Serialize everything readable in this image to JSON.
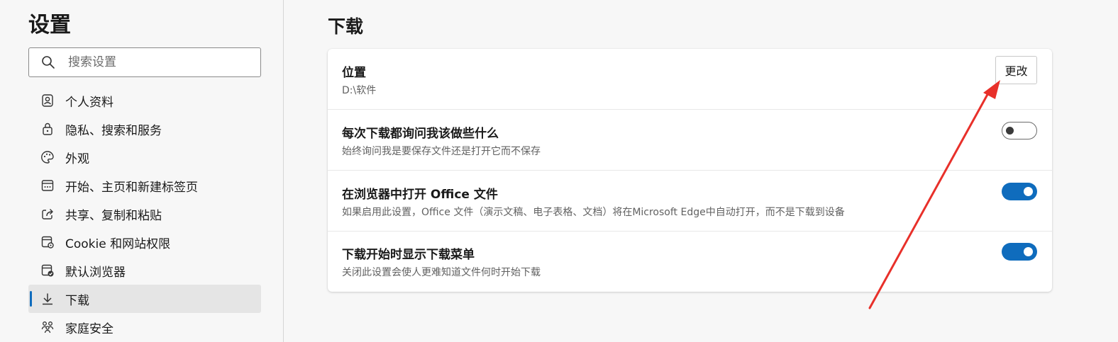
{
  "sidebar": {
    "title": "设置",
    "search_placeholder": "搜索设置",
    "items": [
      {
        "label": "个人资料",
        "icon": "profile-icon"
      },
      {
        "label": "隐私、搜索和服务",
        "icon": "lock-icon"
      },
      {
        "label": "外观",
        "icon": "palette-icon"
      },
      {
        "label": "开始、主页和新建标签页",
        "icon": "start-page-icon"
      },
      {
        "label": "共享、复制和粘贴",
        "icon": "share-icon"
      },
      {
        "label": "Cookie 和网站权限",
        "icon": "cookie-settings-icon"
      },
      {
        "label": "默认浏览器",
        "icon": "default-browser-icon"
      },
      {
        "label": "下载",
        "icon": "download-icon",
        "active": true
      },
      {
        "label": "家庭安全",
        "icon": "family-icon"
      }
    ]
  },
  "main": {
    "title": "下载",
    "location": {
      "title": "位置",
      "path": "D:\\软件",
      "button_label": "更改"
    },
    "ask_each_download": {
      "title": "每次下载都询问我该做些什么",
      "description": "始终询问我是要保存文件还是打开它而不保存",
      "enabled": false
    },
    "open_office_in_browser": {
      "title": "在浏览器中打开 Office 文件",
      "description": "如果启用此设置，Office 文件（演示文稿、电子表格、文档）将在Microsoft Edge中自动打开，而不是下载到设备",
      "enabled": true
    },
    "show_downloads_menu": {
      "title": "下载开始时显示下载菜单",
      "description": "关闭此设置会使人更难知道文件何时开始下载",
      "enabled": true
    }
  },
  "colors": {
    "accent": "#0f6cbd",
    "annotation_arrow": "#e8302a"
  }
}
